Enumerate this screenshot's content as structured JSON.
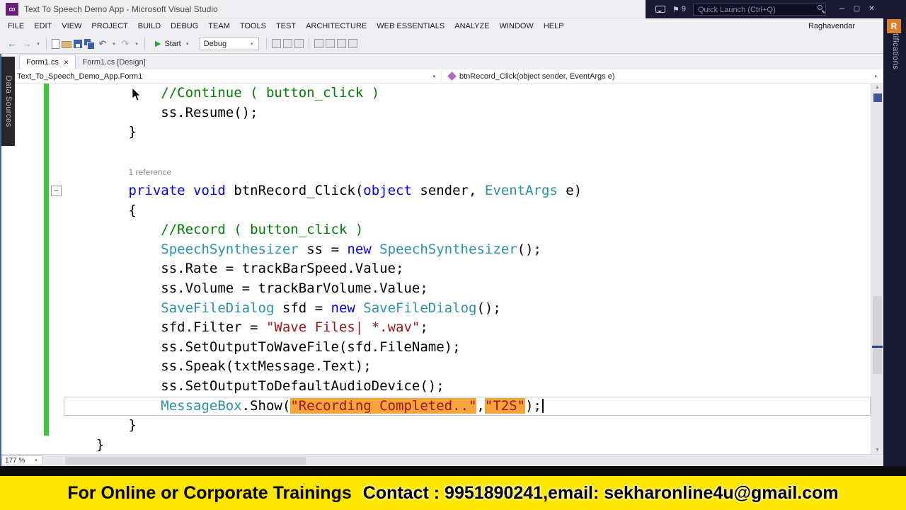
{
  "titlebar": {
    "title": "Text To Speech Demo App - Microsoft Visual Studio",
    "logo_glyph": "∞",
    "notification_count": "9",
    "quick_launch_placeholder": "Quick Launch (Ctrl+Q)"
  },
  "menubar": {
    "items": [
      "FILE",
      "EDIT",
      "VIEW",
      "PROJECT",
      "BUILD",
      "DEBUG",
      "TEAM",
      "TOOLS",
      "TEST",
      "ARCHITECTURE",
      "WEB ESSENTIALS",
      "ANALYZE",
      "WINDOW",
      "HELP"
    ],
    "user_name": "Raghavendar",
    "user_initial": "R"
  },
  "toolbar": {
    "start_label": "Start",
    "config_value": "Debug"
  },
  "tabs": [
    {
      "label": "Form1.cs",
      "active": true
    },
    {
      "label": "Form1.cs [Design]",
      "active": false
    }
  ],
  "navbar": {
    "left": "Text_To_Speech_Demo_App.Form1",
    "right": "btnRecord_Click(object sender, EventArgs e)"
  },
  "side_tabs": {
    "left": "Data Sources",
    "right": "Notifications"
  },
  "editor": {
    "zoom": "177 %",
    "lines": [
      {
        "tokens": [
          [
            "pl",
            "            "
          ],
          [
            "cm",
            "//Continue ( button_click )"
          ]
        ]
      },
      {
        "tokens": [
          [
            "pl",
            "            ss.Resume();"
          ]
        ]
      },
      {
        "tokens": [
          [
            "pl",
            "        }"
          ]
        ]
      },
      {
        "tokens": [
          [
            "pl",
            ""
          ]
        ]
      },
      {
        "tokens": [
          [
            "pl",
            "        "
          ],
          [
            "cl",
            "1 reference"
          ]
        ]
      },
      {
        "tokens": [
          [
            "pl",
            "        "
          ],
          [
            "kw",
            "private"
          ],
          [
            "pl",
            " "
          ],
          [
            "kw",
            "void"
          ],
          [
            "pl",
            " btnRecord_Click("
          ],
          [
            "kw",
            "object"
          ],
          [
            "pl",
            " sender, "
          ],
          [
            "ty",
            "EventArgs"
          ],
          [
            "pl",
            " e)"
          ]
        ]
      },
      {
        "tokens": [
          [
            "pl",
            "        {"
          ]
        ]
      },
      {
        "tokens": [
          [
            "pl",
            "            "
          ],
          [
            "cm",
            "//Record ( button_click )"
          ]
        ]
      },
      {
        "tokens": [
          [
            "pl",
            "            "
          ],
          [
            "ty",
            "SpeechSynthesizer"
          ],
          [
            "pl",
            " ss = "
          ],
          [
            "kw",
            "new"
          ],
          [
            "pl",
            " "
          ],
          [
            "ty",
            "SpeechSynthesizer"
          ],
          [
            "pl",
            "();"
          ]
        ]
      },
      {
        "tokens": [
          [
            "pl",
            "            ss.Rate = trackBarSpeed.Value;"
          ]
        ]
      },
      {
        "tokens": [
          [
            "pl",
            "            ss.Volume = trackBarVolume.Value;"
          ]
        ]
      },
      {
        "tokens": [
          [
            "pl",
            "            "
          ],
          [
            "ty",
            "SaveFileDialog"
          ],
          [
            "pl",
            " sfd = "
          ],
          [
            "kw",
            "new"
          ],
          [
            "pl",
            " "
          ],
          [
            "ty",
            "SaveFileDialog"
          ],
          [
            "pl",
            "();"
          ]
        ]
      },
      {
        "tokens": [
          [
            "pl",
            "            sfd.Filter = "
          ],
          [
            "st",
            "\"Wave Files| *.wav\""
          ],
          [
            "pl",
            ";"
          ]
        ]
      },
      {
        "tokens": [
          [
            "pl",
            "            ss.SetOutputToWaveFile(sfd.FileName);"
          ]
        ]
      },
      {
        "tokens": [
          [
            "pl",
            "            ss.Speak(txtMessage.Text);"
          ]
        ]
      },
      {
        "tokens": [
          [
            "pl",
            "            ss.SetOutputToDefaultAudioDevice();"
          ]
        ]
      },
      {
        "current": true,
        "tokens": [
          [
            "pl",
            "            "
          ],
          [
            "ty",
            "MessageBox"
          ],
          [
            "pl",
            ".Show("
          ],
          [
            "sh",
            "\"Recording Completed..\""
          ],
          [
            "pl",
            ","
          ],
          [
            "sh",
            "\"T2S\""
          ],
          [
            "pl",
            ");"
          ],
          [
            "caret",
            ""
          ]
        ]
      },
      {
        "tokens": [
          [
            "pl",
            "        }"
          ]
        ]
      },
      {
        "tokens": [
          [
            "pl",
            "    }"
          ]
        ]
      }
    ]
  },
  "banner": {
    "part1": "For Online or Corporate Trainings",
    "part2": "Contact : 9951890241",
    "part3": ", ",
    "part4": "email: sekharonline4u@gmail.com"
  },
  "icons": {
    "back": "←",
    "forward": "→",
    "dropdown": "▾",
    "undo": "↶",
    "redo": "↷",
    "start_play": "▶",
    "flag": "⚑",
    "minimize": "─",
    "maximize": "▢",
    "close": "✕",
    "tab_close": "✕",
    "collapse": "−",
    "arrow_up": "▲",
    "arrow_down": "▼"
  },
  "colors": {
    "keyword": "#0000FF",
    "type": "#2B91AF",
    "comment": "#008000",
    "string": "#A31515",
    "string_highlight_bg": "#F5A53C",
    "change_bar_green": "#3FC43F",
    "banner_bg": "#FFE600",
    "avatar_bg": "#D9822B",
    "titlebar_dark": "#191932"
  }
}
